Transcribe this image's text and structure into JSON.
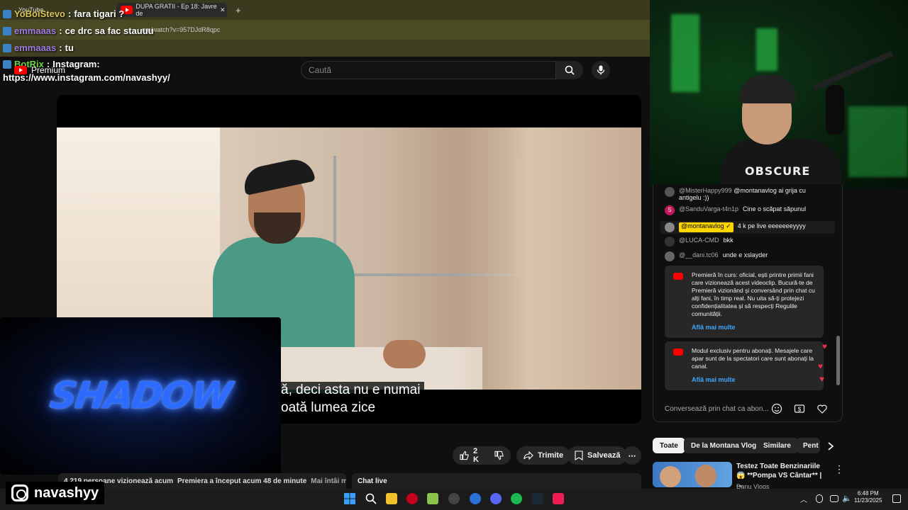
{
  "browser": {
    "tabs": [
      {
        "label": "YouTube"
      },
      {
        "label": "DUPA GRATII - Ep 18: Javre de"
      }
    ],
    "new_tab": "+",
    "url": "om/watch?v=957DJdR8qpc"
  },
  "overlay_chat": [
    {
      "user": "YoBoiStevo",
      "sep": " : ",
      "msg": "fara tigari ?",
      "color": "#d9c35a"
    },
    {
      "user": "emmaaas",
      "sep": " : ",
      "msg": "ce drc sa fac stauuu",
      "color": "#a07be0"
    },
    {
      "user": "emmaaas",
      "sep": " : ",
      "msg": "tu",
      "color": "#a07be0"
    },
    {
      "user": "BotRix",
      "sep": " : ",
      "msg": "Instagram:",
      "color": "#6cd44b"
    }
  ],
  "overlay_link": "https://www.instagram.com/navashyy/",
  "youtube": {
    "logo_text": "Premium",
    "search_placeholder": "Caută",
    "icons": {
      "search": "search-icon",
      "mic": "mic-icon",
      "menu": "menu-icon"
    }
  },
  "video": {
    "subtitle_line1": "ă, deci asta nu e numai",
    "subtitle_line2": "oată lumea zice"
  },
  "shadow_overlay": {
    "text": "SHADOW"
  },
  "actions": {
    "like_count": "2 K",
    "share": "Trimite",
    "save": "Salvează",
    "more": "⋯"
  },
  "info_strip": {
    "viewers": "4.219 persoane vizionează acum",
    "premiere": "Premiera a început acum 48 de minute",
    "members": "Mai întâi membr"
  },
  "chat_live_label": "Chat live",
  "webcam": {
    "shirt_text": "OBSCURE"
  },
  "live_chat": {
    "messages": [
      {
        "author": "@MisterHappy999",
        "text": "@montanavlog ai grija cu antigelu :))",
        "avatar_color": "#555"
      },
      {
        "author": "@SanduVarga-t4n1p",
        "text": "Cine o scăpat săpunul",
        "avatar_color": "#c2185b",
        "avatar_letter": "S"
      },
      {
        "author": "@montanavlog ✓",
        "text": "4 k pe live eeeeeeeyyyy",
        "avatar_color": "#888",
        "highlight": true
      },
      {
        "author": "@LUCA-CMD",
        "text": "bkk",
        "avatar_color": "#333"
      },
      {
        "author": "@__dani.tc06",
        "text": "unde e xslayder",
        "avatar_color": "#666"
      }
    ],
    "system_cards": [
      {
        "text": "Premieră în curs: oficial, ești printre primii fani care vizionează acest videoclip. Bucură-te de Premieră vizionând și conversând prin chat cu alți fani, în timp real. Nu uita să-ți protejezi confidențialitatea și să respecți Regulile comunității.",
        "link": "Află mai multe"
      },
      {
        "text": "Modul exclusiv pentru abonați. Mesajele care apar sunt de la spectatori care sunt abonați la canal.",
        "link": "Află mai multe"
      }
    ],
    "input_placeholder": "Conversează prin chat ca abon..."
  },
  "chips": [
    "Toate",
    "De la Montana Vlog",
    "Similare",
    "Pent"
  ],
  "recommendation": {
    "title": "Testez Toate Benzinariile 😱 **Pompa VS Cântar** | ...",
    "channel": "Danu Vlogs"
  },
  "brand": {
    "name": "navashyy"
  },
  "clock": {
    "time": "6:48 PM",
    "date": "11/23/2025"
  },
  "colors": {
    "accent": "#3ea6ff",
    "youtube_red": "#ff0000",
    "highlight": "#ffd600"
  }
}
